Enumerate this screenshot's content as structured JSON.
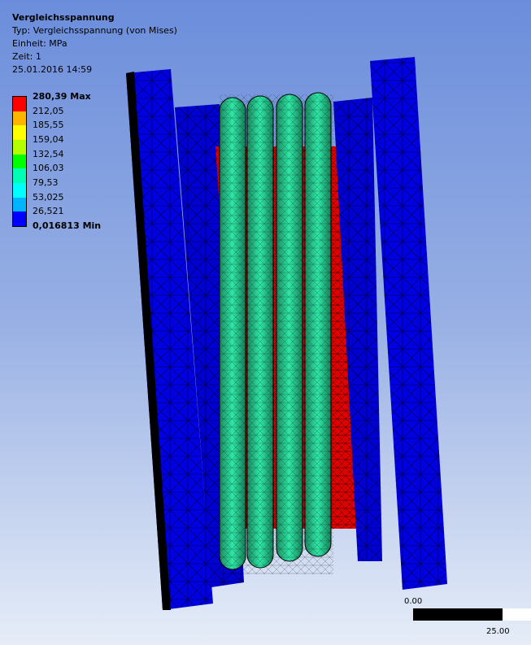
{
  "result": {
    "title": "Vergleichsspannung",
    "type": "Typ: Vergleichsspannung (von Mises)",
    "unit": "Einheit: MPa",
    "time": "Zeit: 1",
    "date": "25.01.2016 14:59"
  },
  "legend": {
    "labels": [
      "280,39 Max",
      "212,05",
      "185,55",
      "159,04",
      "132,54",
      "106,03",
      "79,53",
      "53,025",
      "26,521",
      "0,016813 Min"
    ],
    "colors": [
      "#ff0000",
      "#ffb400",
      "#ffff00",
      "#b4ff00",
      "#00ff00",
      "#00ffb4",
      "#00ffff",
      "#00b4ff",
      "#0000ff"
    ]
  },
  "scale": {
    "start": "0.00",
    "end": "25.00"
  }
}
